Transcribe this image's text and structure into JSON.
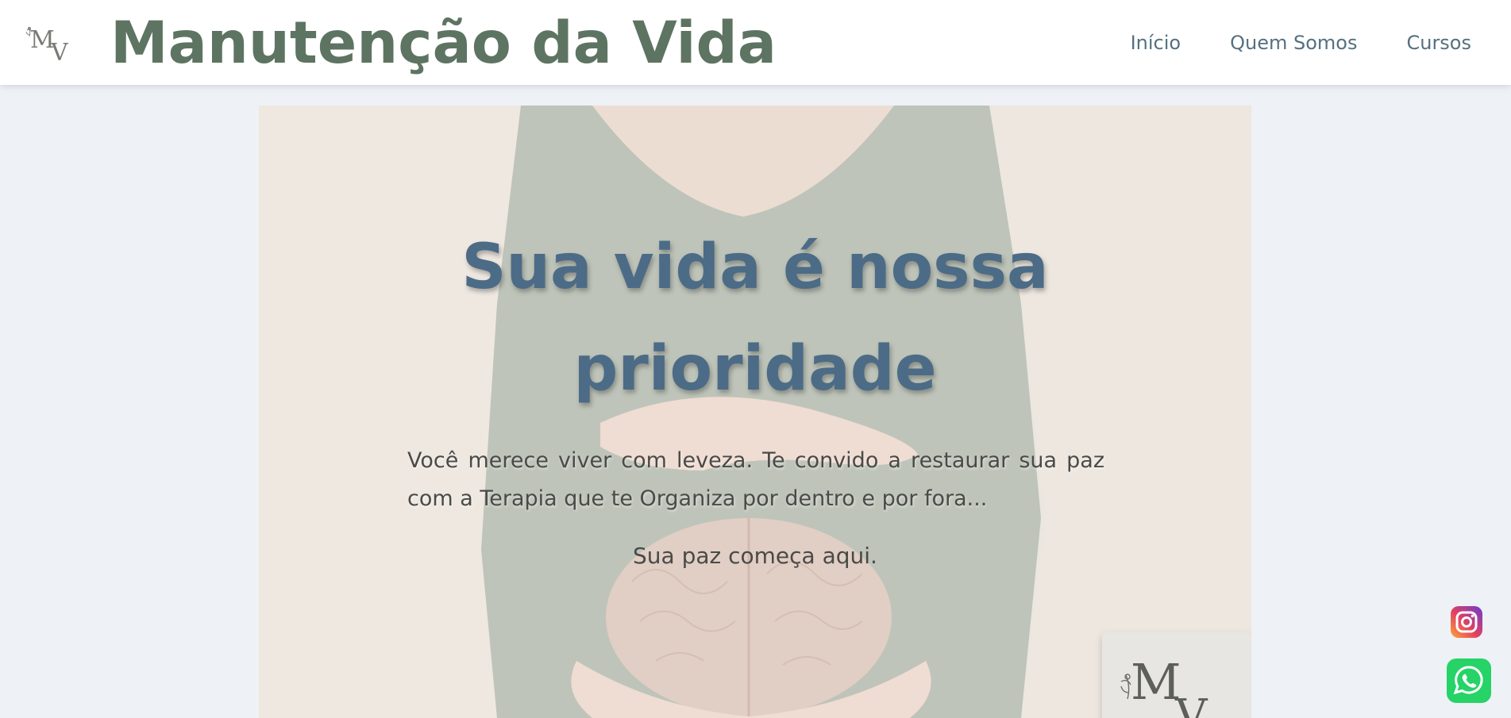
{
  "header": {
    "logo_text": "MV",
    "title": "Manutenção da Vida",
    "nav": [
      {
        "label": "Início"
      },
      {
        "label": "Quem Somos"
      },
      {
        "label": "Cursos"
      }
    ]
  },
  "hero": {
    "title": "Sua vida é nossa prioridade",
    "text": "Você merece viver com leveza. Te convido a restaurar sua paz com a Terapia que te Organiza por dentro e por fora...",
    "tagline": "Sua paz começa aqui.",
    "logo_text": "MV"
  },
  "floating": {
    "instagram_icon": "instagram-icon",
    "whatsapp_icon": "whatsapp-icon"
  },
  "colors": {
    "brand_green": "#5e7462",
    "nav_blue": "#557080",
    "hero_title": "#4c6b86",
    "page_bg": "#eef1f6"
  }
}
